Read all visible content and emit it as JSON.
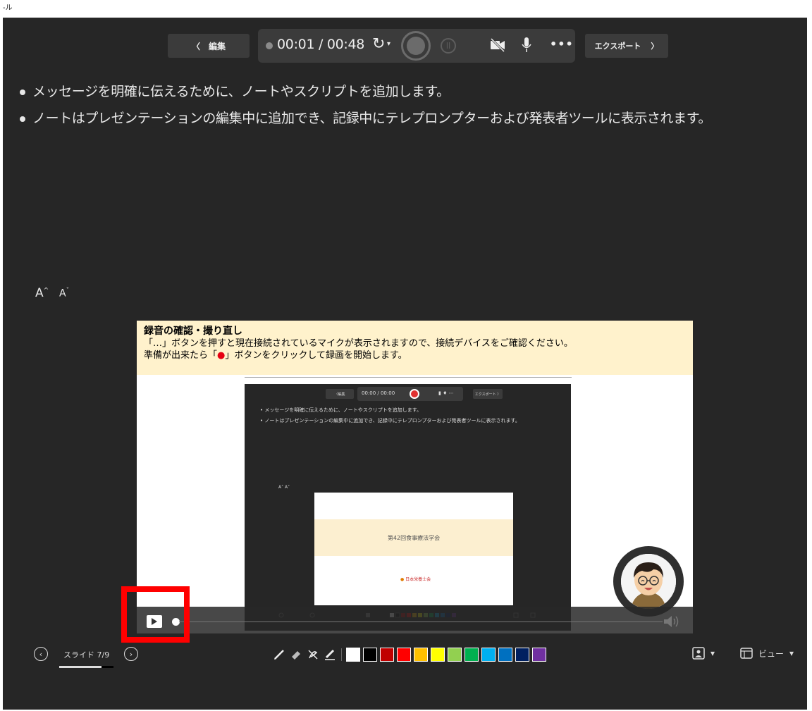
{
  "window": {
    "caption": "-ル"
  },
  "toolbar": {
    "edit_label": "編集",
    "back_chevron": "〈",
    "timer": "00:01 / 00:48",
    "retake_icon": "retake-icon",
    "caret": "▾",
    "more": "•••",
    "export_label": "エクスポート",
    "export_chevron": "〉"
  },
  "notes": {
    "lines": [
      "メッセージを明確に伝えるために、ノートやスクリプトを追加します。",
      "ノートはプレゼンテーションの編集中に追加でき、記録中にテレプロンプターおよび発表者ツールに表示されます。"
    ],
    "font_increase": "A",
    "font_decrease": "A"
  },
  "slide": {
    "title": "録音の確認・撮り直し",
    "line1": "「…」ボタンを押すと現在接続されているマイクが表示されますので、接続デバイスをご確認ください。",
    "line2_pre": "準備が出来たら「",
    "line2_mark": "●",
    "line2_post": "」ボタンをクリックして録画を開始します。",
    "inner": {
      "edit_label": "編集",
      "timer": "00:00 / 00:00",
      "export_label": "エクスポート",
      "note1": "メッセージを明確に伝えるために、ノートやスクリプトを追加します。",
      "note2": "ノートはプレゼンテーションの編集中に追加でき、記録中にテレプロンプターおよび発表者ツールに表示されます。",
      "aa": "A˄  A˅",
      "slide_title": "第42回食事療法学会",
      "logo_text": "日本栄養士会"
    }
  },
  "bottom": {
    "slide_label": "スライド 7/9",
    "slide_progress": 0.78,
    "view_label": "ビュー",
    "caret": "▾"
  },
  "colors": {
    "swatches": [
      "#ffffff",
      "#000000",
      "#c00000",
      "#ff0000",
      "#ffc000",
      "#ffff00",
      "#92d050",
      "#00b050",
      "#00b0f0",
      "#0070c0",
      "#002060",
      "#7030a0"
    ],
    "highlight": "#ff0000",
    "header_bg": "#fff2cc"
  }
}
